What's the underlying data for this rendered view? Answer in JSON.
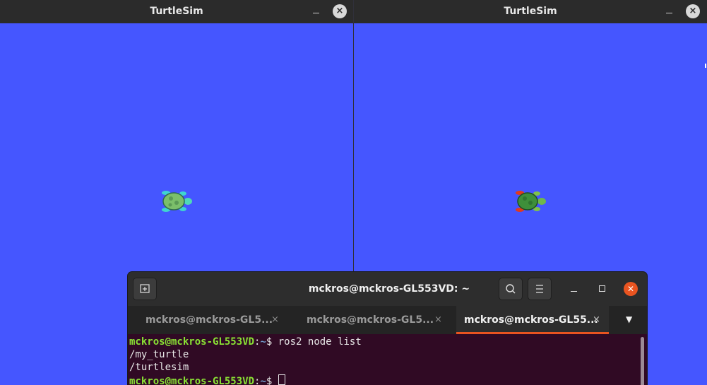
{
  "windows": [
    {
      "title": "TurtleSim",
      "minimize_label": "–",
      "close_label": "×"
    },
    {
      "title": "TurtleSim",
      "minimize_label": "–",
      "close_label": "×"
    }
  ],
  "colors": {
    "sim_background": "#4556ff",
    "titlebar": "#2b2b2b",
    "terminal_bg": "#300a24",
    "accent": "#e95420",
    "prompt_user": "#8ae234",
    "prompt_path": "#729fcf"
  },
  "terminal": {
    "title": "mckros@mckros-GL553VD: ~",
    "new_tab_icon": "new-tab-icon",
    "search_icon": "search-icon",
    "menu_icon": "hamburger-menu-icon",
    "tabs": [
      {
        "label": "mckros@mckros-GL5...",
        "close": "×"
      },
      {
        "label": "mckros@mckros-GL5...",
        "close": "×"
      },
      {
        "label": "mckros@mckros-GL55...",
        "close": "×"
      }
    ],
    "tab_dropdown": "▼",
    "lines": {
      "prompt_user": "mckros@mckros-GL553VD",
      "prompt_colon": ":",
      "prompt_path": "~",
      "prompt_dollar": "$ ",
      "command": "ros2 node list",
      "output_1": "/my_turtle",
      "output_2": "/turtlesim"
    }
  }
}
